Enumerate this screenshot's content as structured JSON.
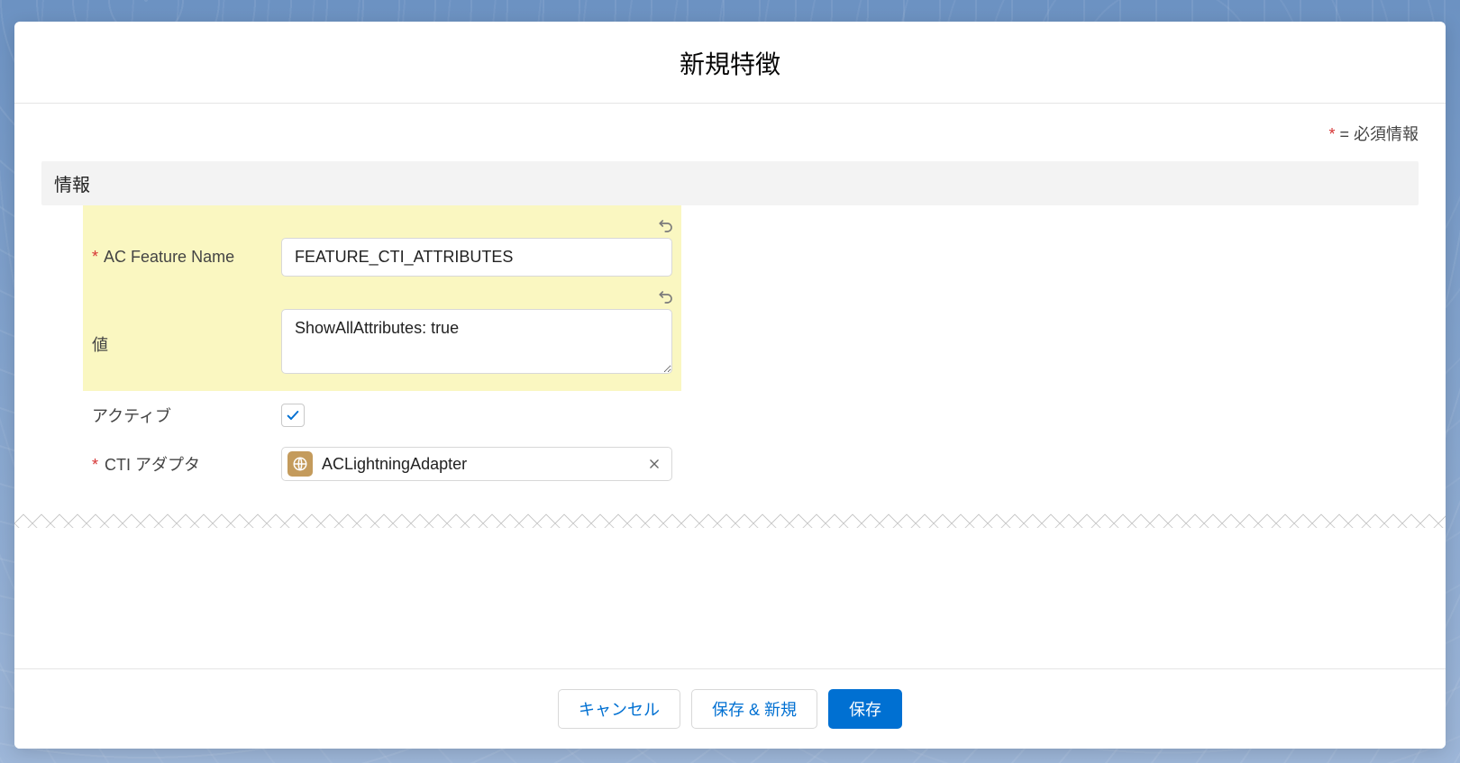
{
  "modal": {
    "title": "新規特徴",
    "required_note_label": " = 必須情報",
    "required_star": "*"
  },
  "section": {
    "info_header": "情報"
  },
  "fields": {
    "feature_name": {
      "label": "AC Feature Name",
      "value": "FEATURE_CTI_ATTRIBUTES",
      "required": true
    },
    "value_field": {
      "label": "値",
      "value": "ShowAllAttributes: true",
      "required": false
    },
    "active": {
      "label": "アクティブ",
      "checked": true
    },
    "cti_adapter": {
      "label": "CTI アダプタ",
      "value": "ACLightningAdapter",
      "required": true
    }
  },
  "buttons": {
    "cancel": "キャンセル",
    "save_new": "保存 & 新規",
    "save": "保存"
  },
  "icons": {
    "undo": "undo-icon",
    "clear": "close-icon",
    "adapter": "adapter-icon",
    "check": "check-icon"
  }
}
